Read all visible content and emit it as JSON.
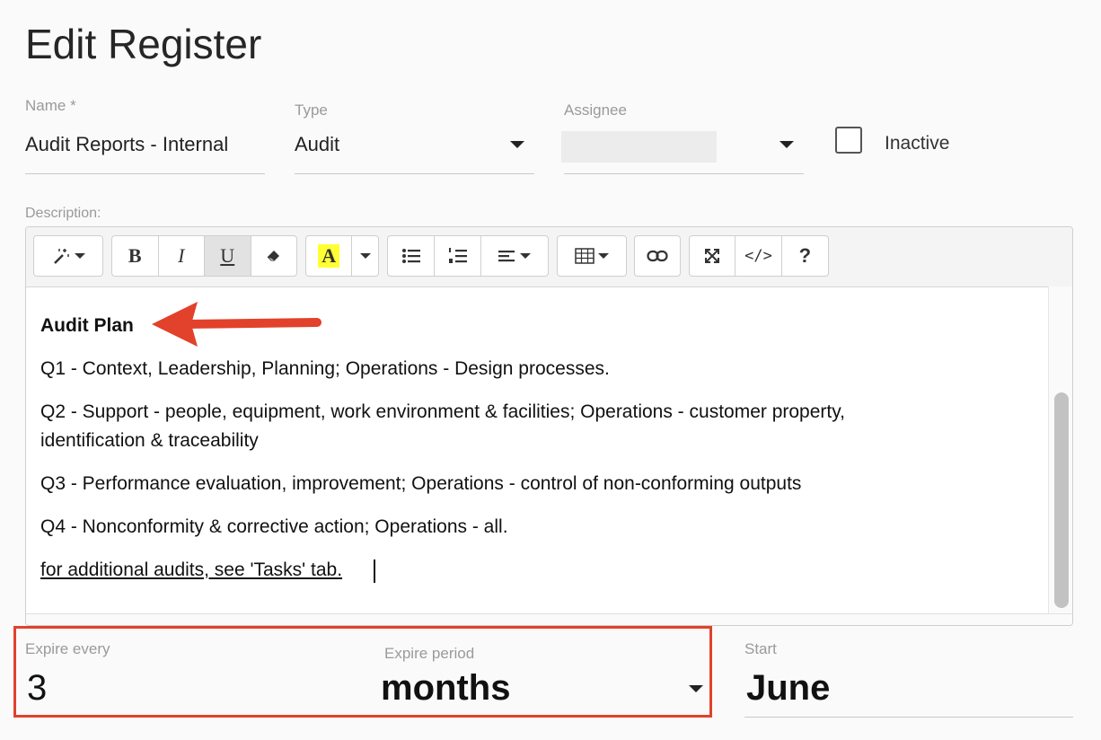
{
  "page": {
    "title": "Edit Register"
  },
  "form": {
    "name": {
      "label": "Name *",
      "value": "Audit Reports - Internal"
    },
    "type": {
      "label": "Type",
      "value": "Audit"
    },
    "assignee": {
      "label": "Assignee",
      "value": ""
    },
    "inactive": {
      "label": "Inactive",
      "checked": false
    },
    "description": {
      "label": "Description:"
    },
    "expire_every": {
      "label": "Expire every",
      "value": "3"
    },
    "expire_period": {
      "label": "Expire period",
      "value": "months"
    },
    "start": {
      "label": "Start",
      "value": "June"
    }
  },
  "toolbar": {
    "magic": "magic-wand-icon",
    "bold": "B",
    "italic": "I",
    "underline": "U",
    "eraser": "eraser-icon",
    "color": "A",
    "highlight_color": "#ffff33",
    "unordered_list": "bullet-list-icon",
    "ordered_list": "numbered-list-icon",
    "align": "align-icon",
    "table": "table-icon",
    "link": "link-icon",
    "fullscreen": "fullscreen-icon",
    "code": "</>",
    "help": "?"
  },
  "editor_content": {
    "heading": "Audit Plan",
    "q1": "Q1 - Context, Leadership, Planning; Operations - Design processes.",
    "q2_line1": "Q2 - Support - people, equipment, work environment & facilities; Operations - customer property,",
    "q2_line2": "identification & traceability",
    "q3": "Q3 - Performance evaluation, improvement; Operations - control of non-conforming outputs",
    "q4": "Q4 - Nonconformity & corrective action; Operations - all.",
    "footer_link": "for additional audits, see 'Tasks' tab."
  },
  "colors": {
    "annotation_red": "#e2412b",
    "accent": "#222222"
  }
}
